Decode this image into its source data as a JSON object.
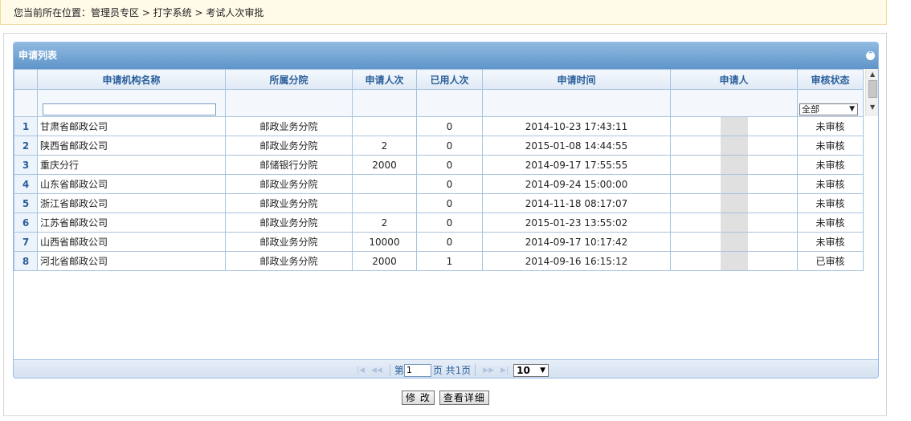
{
  "breadcrumb": "您当前所在位置：管理员专区 > 打字系统 > 考试人次审批",
  "panel": {
    "title": "申请列表"
  },
  "columns": [
    "申请机构名称",
    "所属分院",
    "申请人次",
    "已用人次",
    "申请时间",
    "申请人",
    "审核状态"
  ],
  "filter": {
    "name_value": "",
    "status_selected": "全部"
  },
  "rows": [
    {
      "no": "1",
      "org": "甘肃省邮政公司",
      "branch": "邮政业务分院",
      "applied": "",
      "used": "0",
      "time": "2014-10-23 17:43:11",
      "status": "未审核"
    },
    {
      "no": "2",
      "org": "陕西省邮政公司",
      "branch": "邮政业务分院",
      "applied": "2",
      "used": "0",
      "time": "2015-01-08 14:44:55",
      "status": "未审核"
    },
    {
      "no": "3",
      "org": "重庆分行",
      "branch": "邮储银行分院",
      "applied": "2000",
      "used": "0",
      "time": "2014-09-17 17:55:55",
      "status": "未审核"
    },
    {
      "no": "4",
      "org": "山东省邮政公司",
      "branch": "邮政业务分院",
      "applied": "",
      "used": "0",
      "time": "2014-09-24 15:00:00",
      "status": "未审核"
    },
    {
      "no": "5",
      "org": "浙江省邮政公司",
      "branch": "邮政业务分院",
      "applied": "",
      "used": "0",
      "time": "2014-11-18 08:17:07",
      "status": "未审核"
    },
    {
      "no": "6",
      "org": "江苏省邮政公司",
      "branch": "邮政业务分院",
      "applied": "2",
      "used": "0",
      "time": "2015-01-23 13:55:02",
      "status": "未审核"
    },
    {
      "no": "7",
      "org": "山西省邮政公司",
      "branch": "邮政业务分院",
      "applied": "10000",
      "used": "0",
      "time": "2014-09-17 10:17:42",
      "status": "未审核"
    },
    {
      "no": "8",
      "org": "河北省邮政公司",
      "branch": "邮政业务分院",
      "applied": "2000",
      "used": "1",
      "time": "2014-09-16 16:15:12",
      "status": "已审核"
    }
  ],
  "pager": {
    "page_prefix": "第",
    "page_value": "1",
    "page_suffix": "页 共1页",
    "page_size": "10"
  },
  "buttons": {
    "edit": "修 改",
    "detail": "查看详细"
  }
}
